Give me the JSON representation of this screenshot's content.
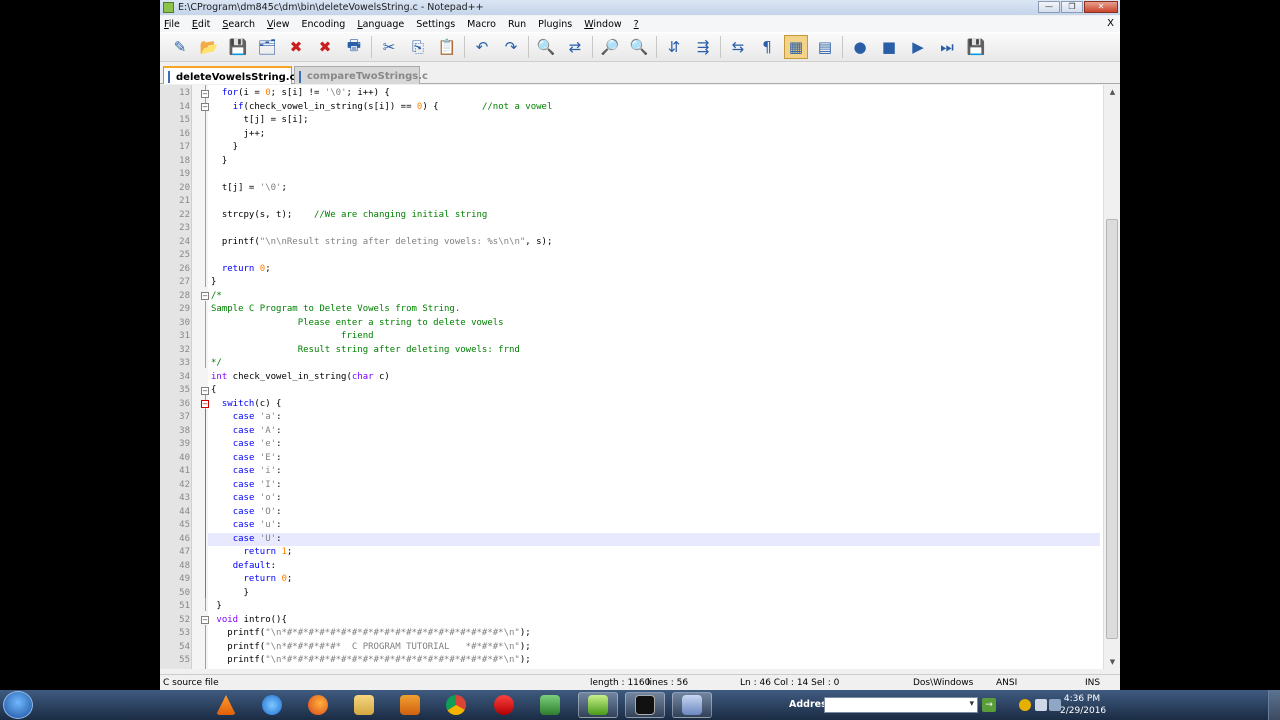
{
  "window": {
    "title": "E:\\CProgram\\dm845c\\dm\\bin\\deleteVowelsString.c - Notepad++",
    "controls": [
      "—",
      "❐",
      "✕"
    ]
  },
  "menu": {
    "items": [
      {
        "u": "F",
        "rest": "ile"
      },
      {
        "u": "E",
        "rest": "dit"
      },
      {
        "u": "S",
        "rest": "earch"
      },
      {
        "u": "V",
        "rest": "iew"
      },
      {
        "u": "",
        "rest": "Encoding"
      },
      {
        "u": "L",
        "rest": "anguage"
      },
      {
        "u": "",
        "rest": "Settings"
      },
      {
        "u": "",
        "rest": "Macro"
      },
      {
        "u": "",
        "rest": "Run"
      },
      {
        "u": "",
        "rest": "Plugins"
      },
      {
        "u": "W",
        "rest": "indow"
      },
      {
        "u": "?",
        "rest": ""
      }
    ],
    "close": "X"
  },
  "toolbar": {
    "icons": [
      "new-file-icon",
      "open-file-icon",
      "save-icon",
      "save-all-icon",
      "close-icon",
      "close-all-icon",
      "print-icon",
      "sep",
      "cut-icon",
      "copy-icon",
      "paste-icon",
      "sep",
      "undo-icon",
      "redo-icon",
      "sep",
      "find-icon",
      "replace-icon",
      "sep",
      "zoom-in-icon",
      "zoom-out-icon",
      "sep",
      "sync-vertical-icon",
      "sync-horizontal-icon",
      "sep",
      "wrap-icon",
      "show-all-chars-icon",
      "indent-guide-icon",
      "doc-map-icon",
      "sep",
      "record-macro-icon",
      "stop-macro-icon",
      "play-macro-icon",
      "run-macro-multiple-icon",
      "save-macro-icon"
    ],
    "glyphs": [
      "✎",
      "📂",
      "💾",
      "🗂",
      "✖",
      "✖",
      "🖶",
      "",
      "✂",
      "⎘",
      "📋",
      "",
      "↶",
      "↷",
      "",
      "🔍",
      "⇄",
      "",
      "🔎",
      "🔍",
      "",
      "⇵",
      "⇶",
      "",
      "⇆",
      "¶",
      "▦",
      "▤",
      "",
      "●",
      "■",
      "▶",
      "⏭",
      "💾"
    ],
    "selected_index": 26
  },
  "tabs": [
    {
      "label": "deleteVowelsString.c",
      "active": true
    },
    {
      "label": "compareTwoStrings.c",
      "active": false
    }
  ],
  "editor": {
    "current_line": 46,
    "lines": [
      {
        "n": "13",
        "t": [
          [
            "  ",
            ""
          ],
          [
            "for",
            "kw"
          ],
          [
            "(i = ",
            ""
          ],
          [
            "0",
            "num"
          ],
          [
            "; s[i] != ",
            ""
          ],
          [
            "'\\0'",
            "str"
          ],
          [
            "; i++) {",
            ""
          ]
        ]
      },
      {
        "n": "14",
        "t": [
          [
            "    ",
            ""
          ],
          [
            "if",
            "kw"
          ],
          [
            "(check_vowel_in_string(s[i]) == ",
            ""
          ],
          [
            "0",
            "num"
          ],
          [
            ") {        ",
            ""
          ],
          [
            "//not a vowel",
            "com"
          ]
        ]
      },
      {
        "n": "15",
        "t": [
          [
            "      t[j] = s[i];",
            ""
          ]
        ]
      },
      {
        "n": "16",
        "t": [
          [
            "      j++;",
            ""
          ]
        ]
      },
      {
        "n": "17",
        "t": [
          [
            "    }",
            ""
          ]
        ]
      },
      {
        "n": "18",
        "t": [
          [
            "  }",
            ""
          ]
        ]
      },
      {
        "n": "19",
        "t": [
          [
            "",
            ""
          ]
        ]
      },
      {
        "n": "20",
        "t": [
          [
            "  t[j] = ",
            ""
          ],
          [
            "'\\0'",
            "str"
          ],
          [
            ";",
            ""
          ]
        ]
      },
      {
        "n": "21",
        "t": [
          [
            "",
            ""
          ]
        ]
      },
      {
        "n": "22",
        "t": [
          [
            "  strcpy(s, t);    ",
            ""
          ],
          [
            "//We are changing initial string",
            "com"
          ]
        ]
      },
      {
        "n": "23",
        "t": [
          [
            "",
            ""
          ]
        ]
      },
      {
        "n": "24",
        "t": [
          [
            "  printf(",
            ""
          ],
          [
            "\"\\n\\nResult string after deleting vowels: %s\\n\\n\"",
            "str"
          ],
          [
            ", s);",
            ""
          ]
        ]
      },
      {
        "n": "25",
        "t": [
          [
            "",
            ""
          ]
        ]
      },
      {
        "n": "26",
        "t": [
          [
            "  ",
            ""
          ],
          [
            "return",
            "kw"
          ],
          [
            " ",
            ""
          ],
          [
            "0",
            "num"
          ],
          [
            ";",
            ""
          ]
        ]
      },
      {
        "n": "27",
        "t": [
          [
            "}",
            ""
          ]
        ]
      },
      {
        "n": "28",
        "t": [
          [
            "/*",
            "com"
          ]
        ]
      },
      {
        "n": "29",
        "t": [
          [
            "Sample C Program to Delete Vowels from String.",
            "com"
          ]
        ]
      },
      {
        "n": "30",
        "t": [
          [
            "                Please enter a string to delete vowels",
            "com"
          ]
        ]
      },
      {
        "n": "31",
        "t": [
          [
            "                        friend",
            "com"
          ]
        ]
      },
      {
        "n": "32",
        "t": [
          [
            "                Result string after deleting vowels: frnd",
            "com"
          ]
        ]
      },
      {
        "n": "33",
        "t": [
          [
            "*/",
            "com"
          ]
        ]
      },
      {
        "n": "34",
        "t": [
          [
            "int",
            "ty"
          ],
          [
            " check_vowel_in_string(",
            ""
          ],
          [
            "char",
            "ty"
          ],
          [
            " c)",
            ""
          ]
        ]
      },
      {
        "n": "35",
        "t": [
          [
            "{",
            ""
          ]
        ]
      },
      {
        "n": "36",
        "t": [
          [
            "  ",
            ""
          ],
          [
            "switch",
            "kw"
          ],
          [
            "(c) {",
            ""
          ]
        ]
      },
      {
        "n": "37",
        "t": [
          [
            "    ",
            ""
          ],
          [
            "case",
            "kw"
          ],
          [
            " ",
            ""
          ],
          [
            "'a'",
            "str"
          ],
          [
            ":",
            ""
          ]
        ]
      },
      {
        "n": "38",
        "t": [
          [
            "    ",
            ""
          ],
          [
            "case",
            "kw"
          ],
          [
            " ",
            ""
          ],
          [
            "'A'",
            "str"
          ],
          [
            ":",
            ""
          ]
        ]
      },
      {
        "n": "39",
        "t": [
          [
            "    ",
            ""
          ],
          [
            "case",
            "kw"
          ],
          [
            " ",
            ""
          ],
          [
            "'e'",
            "str"
          ],
          [
            ":",
            ""
          ]
        ]
      },
      {
        "n": "40",
        "t": [
          [
            "    ",
            ""
          ],
          [
            "case",
            "kw"
          ],
          [
            " ",
            ""
          ],
          [
            "'E'",
            "str"
          ],
          [
            ":",
            ""
          ]
        ]
      },
      {
        "n": "41",
        "t": [
          [
            "    ",
            ""
          ],
          [
            "case",
            "kw"
          ],
          [
            " ",
            ""
          ],
          [
            "'i'",
            "str"
          ],
          [
            ":",
            ""
          ]
        ]
      },
      {
        "n": "42",
        "t": [
          [
            "    ",
            ""
          ],
          [
            "case",
            "kw"
          ],
          [
            " ",
            ""
          ],
          [
            "'I'",
            "str"
          ],
          [
            ":",
            ""
          ]
        ]
      },
      {
        "n": "43",
        "t": [
          [
            "    ",
            ""
          ],
          [
            "case",
            "kw"
          ],
          [
            " ",
            ""
          ],
          [
            "'o'",
            "str"
          ],
          [
            ":",
            ""
          ]
        ]
      },
      {
        "n": "44",
        "t": [
          [
            "    ",
            ""
          ],
          [
            "case",
            "kw"
          ],
          [
            " ",
            ""
          ],
          [
            "'O'",
            "str"
          ],
          [
            ":",
            ""
          ]
        ]
      },
      {
        "n": "45",
        "t": [
          [
            "    ",
            ""
          ],
          [
            "case",
            "kw"
          ],
          [
            " ",
            ""
          ],
          [
            "'u'",
            "str"
          ],
          [
            ":",
            ""
          ]
        ]
      },
      {
        "n": "46",
        "t": [
          [
            "    ",
            ""
          ],
          [
            "case",
            "kw"
          ],
          [
            " ",
            ""
          ],
          [
            "'U'",
            "str"
          ],
          [
            ":",
            ""
          ]
        ]
      },
      {
        "n": "47",
        "t": [
          [
            "      ",
            ""
          ],
          [
            "return",
            "kw"
          ],
          [
            " ",
            ""
          ],
          [
            "1",
            "num"
          ],
          [
            ";",
            ""
          ]
        ]
      },
      {
        "n": "48",
        "t": [
          [
            "    ",
            ""
          ],
          [
            "default",
            "kw"
          ],
          [
            ":",
            ""
          ]
        ]
      },
      {
        "n": "49",
        "t": [
          [
            "      ",
            ""
          ],
          [
            "return",
            "kw"
          ],
          [
            " ",
            ""
          ],
          [
            "0",
            "num"
          ],
          [
            ";",
            ""
          ]
        ]
      },
      {
        "n": "50",
        "t": [
          [
            "      }",
            ""
          ]
        ]
      },
      {
        "n": "51",
        "t": [
          [
            " }",
            ""
          ]
        ]
      },
      {
        "n": "52",
        "t": [
          [
            " ",
            ""
          ],
          [
            "void",
            "ty"
          ],
          [
            " intro(){",
            ""
          ]
        ]
      },
      {
        "n": "53",
        "t": [
          [
            "   printf(",
            ""
          ],
          [
            "\"\\n*#*#*#*#*#*#*#*#*#*#*#*#*#*#*#*#*#*#*#*#*\\n\"",
            "str"
          ],
          [
            ");",
            ""
          ]
        ]
      },
      {
        "n": "54",
        "t": [
          [
            "   printf(",
            ""
          ],
          [
            "\"\\n*#*#*#*#*#*  C PROGRAM TUTORIAL   *#*#*#*\\n\"",
            "str"
          ],
          [
            ");",
            ""
          ]
        ]
      },
      {
        "n": "55",
        "t": [
          [
            "   printf(",
            ""
          ],
          [
            "\"\\n*#*#*#*#*#*#*#*#*#*#*#*#*#*#*#*#*#*#*#*#*\\n\"",
            "str"
          ],
          [
            ");",
            ""
          ]
        ]
      }
    ]
  },
  "status": {
    "lang": "C source file",
    "length": "length : 1160",
    "lines": "lines : 56",
    "pos": "Ln : 46    Col : 14    Sel : 0",
    "eol": "Dos\\Windows",
    "enc": "ANSI",
    "mode": "INS"
  },
  "taskbar": {
    "address_label": "Address",
    "go": "→",
    "time": "4:36 PM",
    "date": "2/29/2016"
  }
}
